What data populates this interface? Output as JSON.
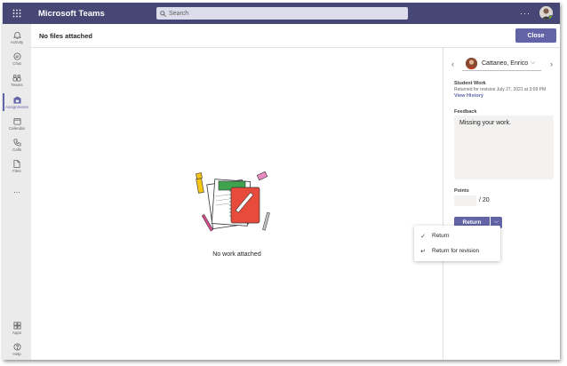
{
  "app": {
    "title": "Microsoft Teams"
  },
  "search": {
    "placeholder": "Search"
  },
  "topbar": {
    "more_icon": "more-horizontal-icon"
  },
  "rail": {
    "items": [
      {
        "label": "Activity",
        "icon": "bell-icon"
      },
      {
        "label": "Chat",
        "icon": "chat-icon"
      },
      {
        "label": "Teams",
        "icon": "teams-icon"
      },
      {
        "label": "Assignments",
        "icon": "assignments-icon",
        "active": true
      },
      {
        "label": "Calendar",
        "icon": "calendar-icon"
      },
      {
        "label": "Calls",
        "icon": "phone-icon"
      },
      {
        "label": "Files",
        "icon": "file-icon"
      },
      {
        "label": "...",
        "icon": "more-icon"
      }
    ],
    "bottom": [
      {
        "label": "Apps",
        "icon": "apps-icon"
      },
      {
        "label": "Help",
        "icon": "help-icon"
      }
    ]
  },
  "header": {
    "title": "No files attached",
    "close_label": "Close"
  },
  "main": {
    "empty_text": "No work attached"
  },
  "panel": {
    "student_name": "Cattaneo, Enrico",
    "student_work_label": "Student Work",
    "status": "Returned for revision July 27, 2021 at 3:09 PM",
    "view_history": "View History",
    "feedback_label": "Feedback",
    "feedback_text": "Missing your work.",
    "points_label": "Points",
    "points_value": "",
    "points_total": "/ 20",
    "return_label": "Return"
  },
  "dropdown": {
    "items": [
      {
        "label": "Return",
        "icon": "checkmark-icon"
      },
      {
        "label": "Return for revision",
        "icon": "return-arrow-icon"
      }
    ]
  },
  "colors": {
    "brand": "#464775",
    "accent": "#6264a7",
    "rail": "#ebebeb"
  }
}
